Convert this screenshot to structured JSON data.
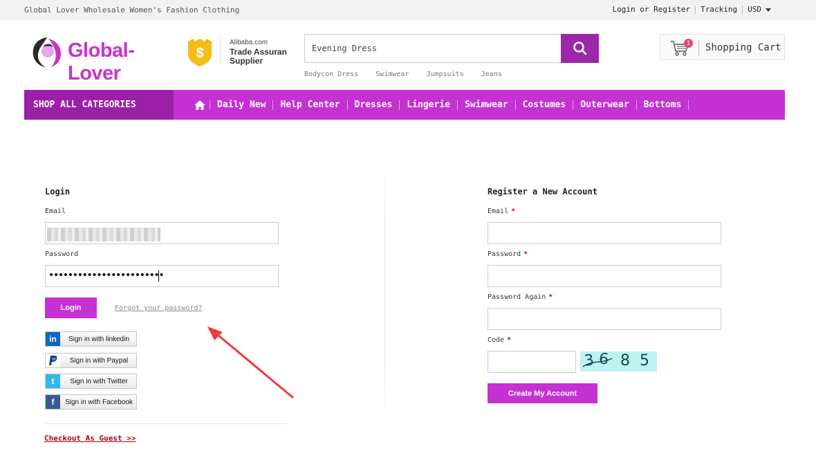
{
  "topbar": {
    "tagline": "Global Lover Wholesale Women's Fashion Clothing",
    "login_register": "Login or Register",
    "tracking": "Tracking",
    "currency": "USD"
  },
  "header": {
    "logo_text": "Global-Lover",
    "trade_line1": "Alibaba.com",
    "trade_line2": "Trade Assuran",
    "trade_line3": "Supplier",
    "search_value": "Evening Dress",
    "hotwords": [
      "Bodycon Dress",
      "Swimwear",
      "Jumpsuits",
      "Jeans"
    ],
    "cart_count": "1",
    "cart_label": "Shopping Cart"
  },
  "nav": {
    "categories_label": "SHOP ALL CATEGORIES",
    "items": [
      "Daily New",
      "Help Center",
      "Dresses",
      "Lingerie",
      "Swimwear",
      "Costumes",
      "Outerwear",
      "Bottoms"
    ]
  },
  "login": {
    "title": "Login",
    "email_label": "Email",
    "password_label": "Password",
    "password_dots": "••••••••••••••••••••••••",
    "login_button": "Login",
    "forgot_link": "Forgot your password?",
    "social": [
      {
        "label": "Sign in with linkedin",
        "icon": "linkedin-icon",
        "color": "#0a66c2"
      },
      {
        "label": "Sign in with Paypal",
        "icon": "paypal-icon",
        "color": "#1d3f8f"
      },
      {
        "label": "Sign in with Twitter",
        "icon": "twitter-icon",
        "color": "#35b9e8"
      },
      {
        "label": "Sign in with Facebook",
        "icon": "facebook-icon",
        "color": "#3b5998"
      }
    ],
    "guest_link": "Checkout As Guest >>"
  },
  "register": {
    "title": "Register a New Account",
    "email_label": "Email",
    "password_label": "Password",
    "password_again_label": "Password Again",
    "code_label": "Code",
    "required_mark": "*",
    "captcha": [
      "3",
      "6",
      "8",
      "5"
    ],
    "create_button": "Create My Account"
  },
  "colors": {
    "brand_purple": "#c531d3",
    "dark_purple": "#9c1fa8",
    "guest_red": "#b0000b"
  }
}
